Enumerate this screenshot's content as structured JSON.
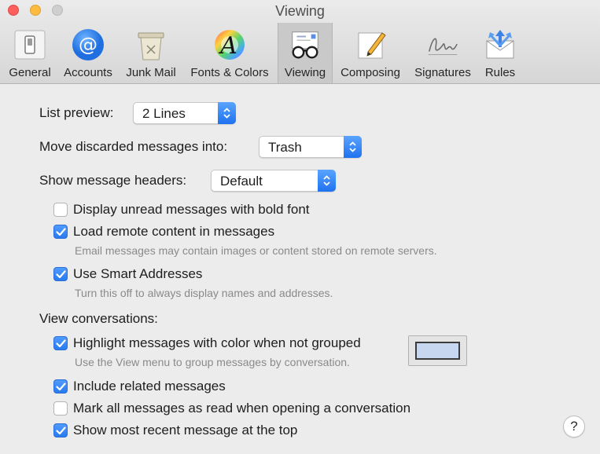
{
  "window": {
    "title": "Viewing",
    "help_label": "?"
  },
  "toolbar": {
    "active_tab": "Viewing",
    "tabs": [
      {
        "label": "General",
        "icon": "switch-icon"
      },
      {
        "label": "Accounts",
        "icon": "at-sign-icon"
      },
      {
        "label": "Junk Mail",
        "icon": "trash-can-icon"
      },
      {
        "label": "Fonts & Colors",
        "icon": "color-wheel-icon"
      },
      {
        "label": "Viewing",
        "icon": "glasses-envelope-icon"
      },
      {
        "label": "Composing",
        "icon": "pencil-paper-icon"
      },
      {
        "label": "Signatures",
        "icon": "signature-icon"
      },
      {
        "label": "Rules",
        "icon": "envelope-arrows-icon"
      }
    ]
  },
  "settings": {
    "list_preview": {
      "label": "List preview:",
      "value": "2 Lines"
    },
    "move_discarded": {
      "label": "Move discarded messages into:",
      "value": "Trash"
    },
    "show_headers": {
      "label": "Show message headers:",
      "value": "Default"
    },
    "options": {
      "bold_unread": {
        "label": "Display unread messages with bold font",
        "checked": false
      },
      "remote_content": {
        "label": "Load remote content in messages",
        "checked": true,
        "hint": "Email messages may contain images or content stored on remote servers."
      },
      "smart_addresses": {
        "label": "Use Smart Addresses",
        "checked": true,
        "hint": "Turn this off to always display names and addresses."
      }
    },
    "conversations": {
      "heading": "View conversations:",
      "highlight": {
        "label": "Highlight messages with color when not grouped",
        "checked": true,
        "hint": "Use the View menu to group messages by conversation.",
        "color": "#c7d7ef"
      },
      "include_related": {
        "label": "Include related messages",
        "checked": true
      },
      "mark_read": {
        "label": "Mark all messages as read when opening a conversation",
        "checked": false
      },
      "recent_top": {
        "label": "Show most recent message at the top",
        "checked": true
      }
    }
  },
  "colors": {
    "accent": "#2a7af0",
    "toolbar_bg": "#d9d9d9",
    "window_bg": "#ececec"
  }
}
